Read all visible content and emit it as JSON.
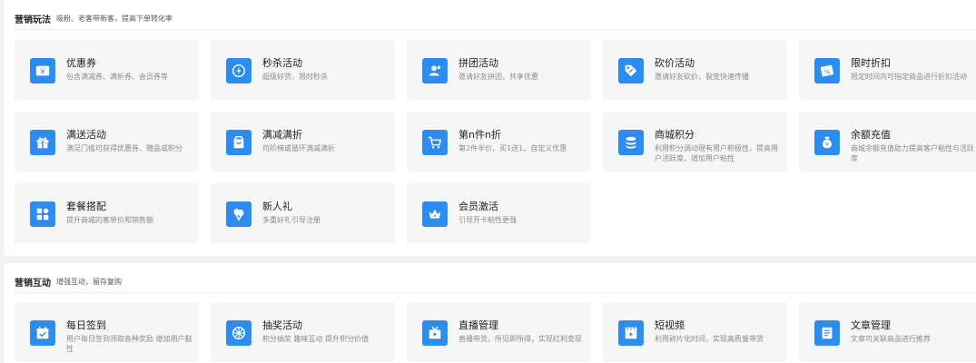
{
  "marketing": {
    "title": "营销玩法",
    "subtitle": "吸粉、老客带新客，提高下单转化率",
    "items": [
      {
        "title": "优惠券",
        "desc": "包含满减券、满折券、会员券等",
        "icon": "coupon-icon"
      },
      {
        "title": "秒杀活动",
        "desc": "超级好货，限时秒杀",
        "icon": "flash-sale-icon"
      },
      {
        "title": "拼团活动",
        "desc": "邀请好友拼团，共享优惠",
        "icon": "group-buy-icon"
      },
      {
        "title": "砍价活动",
        "desc": "邀请好友砍价，裂变快速传播",
        "icon": "bargain-tag-icon"
      },
      {
        "title": "限时折扣",
        "desc": "限定时间内可指定商品进行折扣活动",
        "icon": "discount-ticket-icon"
      },
      {
        "title": "满送活动",
        "desc": "满足门槛可获得优惠券、赠品或积分",
        "icon": "gift-icon"
      },
      {
        "title": "满减满折",
        "desc": "可阶梯或循环满减满折",
        "icon": "shopping-bag-icon"
      },
      {
        "title": "第n件n折",
        "desc": "第2件半价、买1送1、自定义优惠",
        "icon": "cart-icon"
      },
      {
        "title": "商城积分",
        "desc": "利用积分调动現有用户积极性，提高用户活跃度、增加用户粘性",
        "icon": "coins-icon"
      },
      {
        "title": "余额充值",
        "desc": "商城余额充值助力提高客户粘性与活跃度",
        "icon": "money-bag-icon"
      },
      {
        "title": "套餐搭配",
        "desc": "提升商城的客单价和销售额",
        "icon": "grid-icon"
      },
      {
        "title": "新人礼",
        "desc": "多重好礼引导注册",
        "icon": "balloons-icon"
      },
      {
        "title": "会员激活",
        "desc": "引导开卡粘性更强",
        "icon": "crown-icon"
      }
    ]
  },
  "interaction": {
    "title": "营销互动",
    "subtitle": "增强互动，留存复购",
    "items": [
      {
        "title": "每日签到",
        "desc": "用户每日签到领取各种奖励 增加用户黏性",
        "icon": "calendar-check-icon"
      },
      {
        "title": "抽奖活动",
        "desc": "积分抽奖 趣味互动 提升积分价值",
        "icon": "lottery-wheel-icon"
      },
      {
        "title": "直播管理",
        "desc": "直播带货，所见即所得，实现红利变现",
        "icon": "live-tv-icon"
      },
      {
        "title": "短视频",
        "desc": "利用碎片化时间，实现高质量带货",
        "icon": "video-icon"
      },
      {
        "title": "文章管理",
        "desc": "文章可关联商品进行推荐",
        "icon": "article-icon"
      }
    ]
  },
  "colors": {
    "icon_bg": "#2d8cf0",
    "card_bg": "#f5f6f8"
  }
}
